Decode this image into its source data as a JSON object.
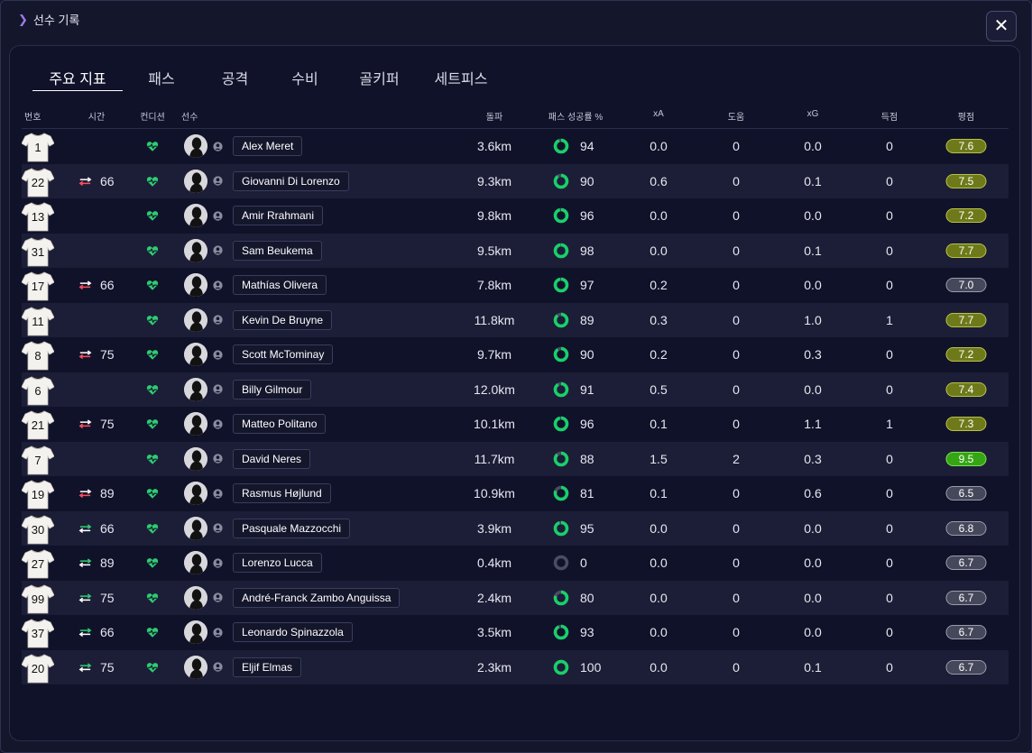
{
  "breadcrumb": "선수 기록",
  "close_label": "✕",
  "tabs": [
    {
      "label": "주요 지표",
      "active": true
    },
    {
      "label": "패스",
      "active": false
    },
    {
      "label": "공격",
      "active": false
    },
    {
      "label": "수비",
      "active": false
    },
    {
      "label": "골키퍼",
      "active": false
    },
    {
      "label": "세트피스",
      "active": false
    }
  ],
  "columns": {
    "number": "번호",
    "time": "시간",
    "condition": "컨디션",
    "player": "선수",
    "distance": "돌파",
    "pass_pct": "패스 성공률 %",
    "xa": "xA",
    "assists": "도움",
    "xg": "xG",
    "goals": "득점",
    "rating": "평점"
  },
  "colors": {
    "accent": "#a07ae8",
    "heart": "#2ecc71",
    "donut_ring": "#18d06a",
    "sub_in": "#ff4d5e",
    "sub_out": "#2ecc71",
    "rating_olive": "#6e7a1a",
    "rating_green": "#35a514",
    "rating_grey": "#45475a"
  },
  "players": [
    {
      "number": "1",
      "time": "",
      "sub": "",
      "name": "Alex Meret",
      "distance": "3.6km",
      "pass_pct": "94",
      "xa": "0.0",
      "assists": "0",
      "xg": "0.0",
      "goals": "0",
      "rating": "7.6",
      "rating_style": "olive"
    },
    {
      "number": "22",
      "time": "66",
      "sub": "off",
      "name": "Giovanni Di Lorenzo",
      "distance": "9.3km",
      "pass_pct": "90",
      "xa": "0.6",
      "assists": "0",
      "xg": "0.1",
      "goals": "0",
      "rating": "7.5",
      "rating_style": "olive"
    },
    {
      "number": "13",
      "time": "",
      "sub": "",
      "name": "Amir Rrahmani",
      "distance": "9.8km",
      "pass_pct": "96",
      "xa": "0.0",
      "assists": "0",
      "xg": "0.0",
      "goals": "0",
      "rating": "7.2",
      "rating_style": "olive"
    },
    {
      "number": "31",
      "time": "",
      "sub": "",
      "name": "Sam Beukema",
      "distance": "9.5km",
      "pass_pct": "98",
      "xa": "0.0",
      "assists": "0",
      "xg": "0.1",
      "goals": "0",
      "rating": "7.7",
      "rating_style": "olive"
    },
    {
      "number": "17",
      "time": "66",
      "sub": "off",
      "name": "Mathías Olivera",
      "distance": "7.8km",
      "pass_pct": "97",
      "xa": "0.2",
      "assists": "0",
      "xg": "0.0",
      "goals": "0",
      "rating": "7.0",
      "rating_style": "grey"
    },
    {
      "number": "11",
      "time": "",
      "sub": "",
      "name": "Kevin De Bruyne",
      "distance": "11.8km",
      "pass_pct": "89",
      "xa": "0.3",
      "assists": "0",
      "xg": "1.0",
      "goals": "1",
      "rating": "7.7",
      "rating_style": "olive"
    },
    {
      "number": "8",
      "time": "75",
      "sub": "off",
      "name": "Scott McTominay",
      "distance": "9.7km",
      "pass_pct": "90",
      "xa": "0.2",
      "assists": "0",
      "xg": "0.3",
      "goals": "0",
      "rating": "7.2",
      "rating_style": "olive"
    },
    {
      "number": "6",
      "time": "",
      "sub": "",
      "name": "Billy Gilmour",
      "distance": "12.0km",
      "pass_pct": "91",
      "xa": "0.5",
      "assists": "0",
      "xg": "0.0",
      "goals": "0",
      "rating": "7.4",
      "rating_style": "olive"
    },
    {
      "number": "21",
      "time": "75",
      "sub": "off",
      "name": "Matteo Politano",
      "distance": "10.1km",
      "pass_pct": "96",
      "xa": "0.1",
      "assists": "0",
      "xg": "1.1",
      "goals": "1",
      "rating": "7.3",
      "rating_style": "olive"
    },
    {
      "number": "7",
      "time": "",
      "sub": "",
      "name": "David Neres",
      "distance": "11.7km",
      "pass_pct": "88",
      "xa": "1.5",
      "assists": "2",
      "xg": "0.3",
      "goals": "0",
      "rating": "9.5",
      "rating_style": "green"
    },
    {
      "number": "19",
      "time": "89",
      "sub": "off",
      "name": "Rasmus Højlund",
      "distance": "10.9km",
      "pass_pct": "81",
      "xa": "0.1",
      "assists": "0",
      "xg": "0.6",
      "goals": "0",
      "rating": "6.5",
      "rating_style": "grey"
    },
    {
      "number": "30",
      "time": "66",
      "sub": "on",
      "name": "Pasquale Mazzocchi",
      "distance": "3.9km",
      "pass_pct": "95",
      "xa": "0.0",
      "assists": "0",
      "xg": "0.0",
      "goals": "0",
      "rating": "6.8",
      "rating_style": "grey"
    },
    {
      "number": "27",
      "time": "89",
      "sub": "on",
      "name": "Lorenzo Lucca",
      "distance": "0.4km",
      "pass_pct": "0",
      "xa": "0.0",
      "assists": "0",
      "xg": "0.0",
      "goals": "0",
      "rating": "6.7",
      "rating_style": "grey"
    },
    {
      "number": "99",
      "time": "75",
      "sub": "on",
      "name": "André-Franck Zambo Anguissa",
      "distance": "2.4km",
      "pass_pct": "80",
      "xa": "0.0",
      "assists": "0",
      "xg": "0.0",
      "goals": "0",
      "rating": "6.7",
      "rating_style": "grey"
    },
    {
      "number": "37",
      "time": "66",
      "sub": "on",
      "name": "Leonardo Spinazzola",
      "distance": "3.5km",
      "pass_pct": "93",
      "xa": "0.0",
      "assists": "0",
      "xg": "0.0",
      "goals": "0",
      "rating": "6.7",
      "rating_style": "grey"
    },
    {
      "number": "20",
      "time": "75",
      "sub": "on",
      "name": "Eljif Elmas",
      "distance": "2.3km",
      "pass_pct": "100",
      "xa": "0.0",
      "assists": "0",
      "xg": "0.1",
      "goals": "0",
      "rating": "6.7",
      "rating_style": "grey"
    }
  ]
}
